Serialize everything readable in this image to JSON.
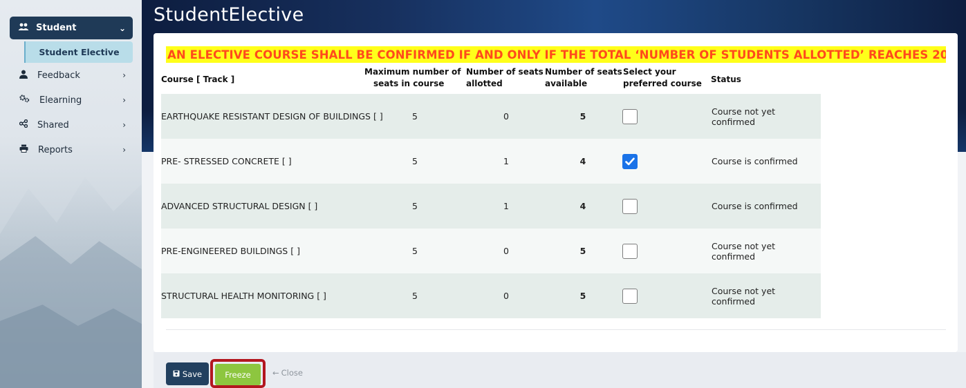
{
  "app": {
    "title": "StudentElective"
  },
  "sidebar": {
    "header": {
      "label": "Student",
      "icon": "users-icon"
    },
    "active_sub": "Student Elective",
    "items": [
      {
        "label": "Feedback",
        "icon": "user-icon"
      },
      {
        "label": "Elearning",
        "icon": "gears-icon"
      },
      {
        "label": "Shared",
        "icon": "share-icon"
      },
      {
        "label": "Reports",
        "icon": "printer-icon"
      }
    ]
  },
  "notice": "AN ELECTIVE COURSE SHALL BE CONFIRMED IF AND ONLY IF THE TOTAL ‘NUMBER OF STUDENTS ALLOTTED’ REACHES 20",
  "table": {
    "headers": {
      "course": "Course [ Track ]",
      "max_1": "Maximum number of",
      "max_2": "seats in course",
      "allot_1": "Number of seats",
      "allot_2": "allotted",
      "avail_1": "Number of seats",
      "avail_2": "available",
      "select_1": "Select your",
      "select_2": "preferred course",
      "status": "Status"
    },
    "rows": [
      {
        "course": "EARTHQUAKE RESISTANT DESIGN OF BUILDINGS [ ]",
        "max": "5",
        "allotted": "0",
        "available": "5",
        "checked": false,
        "status": "Course not yet confirmed"
      },
      {
        "course": "PRE- STRESSED CONCRETE [ ]",
        "max": "5",
        "allotted": "1",
        "available": "4",
        "checked": true,
        "status": "Course is confirmed"
      },
      {
        "course": "ADVANCED STRUCTURAL DESIGN [ ]",
        "max": "5",
        "allotted": "1",
        "available": "4",
        "checked": false,
        "status": "Course is confirmed"
      },
      {
        "course": "PRE-ENGINEERED BUILDINGS [ ]",
        "max": "5",
        "allotted": "0",
        "available": "5",
        "checked": false,
        "status": "Course not yet confirmed"
      },
      {
        "course": "STRUCTURAL HEALTH MONITORING [ ]",
        "max": "5",
        "allotted": "0",
        "available": "5",
        "checked": false,
        "status": "Course not yet confirmed"
      }
    ]
  },
  "buttons": {
    "save": "Save",
    "freeze": "Freeze",
    "close": "Close"
  },
  "colors": {
    "accent": "#1f3a57",
    "notice_bg": "#ffff1a",
    "notice_text": "#ff4a1c",
    "freeze": "#8dc63f",
    "highlight": "#b3161f",
    "check": "#1a73e8"
  }
}
